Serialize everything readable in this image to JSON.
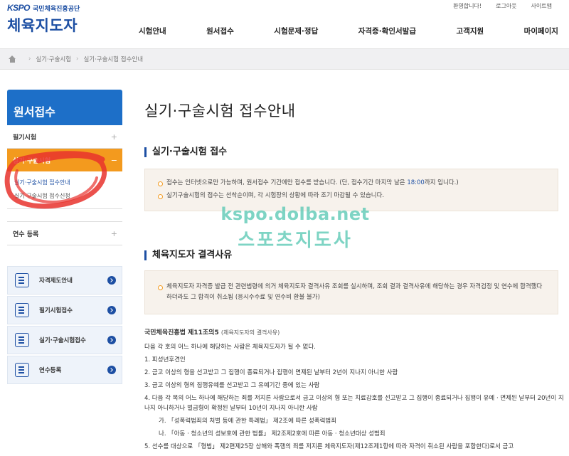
{
  "header": {
    "logo_text": "KSPO",
    "org_name": "국민체육진흥공단",
    "site_title": "체육지도자",
    "util_links": [
      "환영합니다!",
      "로그아웃",
      "사이트맵"
    ],
    "nav": [
      "시험안내",
      "원서접수",
      "시험문제·정답",
      "자격증·확인서발급",
      "고객지원",
      "마이페이지"
    ]
  },
  "breadcrumb": [
    "실기·구술시험",
    "실기·구술시험 접수안내"
  ],
  "sidebar": {
    "title": "원서접수",
    "items": [
      {
        "label": "필기시험",
        "toggle": "+"
      },
      {
        "label": "실기·구술시험",
        "toggle": "−"
      }
    ],
    "sub_items": [
      "실기·구술시험 접수안내",
      "실기·구술시험 접수신청"
    ],
    "enroll": {
      "label": "연수 등록",
      "toggle": "+"
    }
  },
  "quick_menu": [
    {
      "label": "자격제도안내",
      "icon": "qualification-icon"
    },
    {
      "label": "필기시험접수",
      "icon": "document-icon"
    },
    {
      "label": "실기·구술시험접수",
      "icon": "chat-icon"
    },
    {
      "label": "연수등록",
      "icon": "monitor-icon"
    }
  ],
  "main": {
    "page_title": "실기·구술시험 접수안내",
    "section1": {
      "title": "실기·구술시험 접수",
      "line1_a": "접수는 인터넷으로만 가능하며, 원서접수 기간에만 접수를 받습니다. (단, 접수기간 마지막 날은 ",
      "line1_time": "18:00",
      "line1_b": "까지 입니다.)",
      "line2": "실기구술시험의 접수는 선착순이며, 각 시험장의 상황에 따라 조기 마감될 수 있습니다."
    },
    "section2": {
      "title": "체육지도자 결격사유",
      "line": "체육지도자 자격증 발급 전 관련법령에 의거 체육지도자 결격사유 조회를 실시하며, 조회 결과 결격사유에 해당하는 경우 자격검정 및 연수에 합격했다 하더라도 그 합격이 취소됨 (응시수수료 및 연수비 환불 불가)"
    },
    "law": {
      "title": "국민체육진흥법 제11조의5",
      "subtitle": "(체육지도자의 결격사유)",
      "intro": "다음 각 호의 어느 하나에 해당하는 사람은 체육지도자가 될 수 없다.",
      "items": [
        "1. 피성년후견인",
        "2. 금고 이상의 형을 선고받고 그 집행이 종료되거나 집행이 면제된 날부터 2년이 지나지 아니한 사람",
        "3. 금고 이상의 형의 집행유예를 선고받고 그 유예기간 중에 있는 사람",
        "4. 다음 각 목의 어느 하나에 해당하는 죄를 저지른 사람으로서 금고 이상의 형 또는 치료감호를 선고받고 그 집행이 종료되거나 집행이 유예 · 면제된 날부터 20년이 지나지 아니하거나 벌금형이 확정된 날부터 10년이 지나지 아니한 사람"
      ],
      "sub_items": [
        "가. 「성폭력범죄의 처벌 등에 관한 특례법」 제2조에 따른 성폭력범죄",
        "나. 「아동 · 청소년의 성보호에 관한 법률」 제2조제2호에 따른 아동 · 청소년대상 성범죄"
      ],
      "item5": "5. 선수를 대상으로 「형법」 제2편제25장 상해와 폭행의 죄를 저지른 체육지도자(제12조제1항에 따라 자격이 취소된 사람을 포함한다)로서 금고"
    }
  },
  "watermark": {
    "line1": "kspo.dolba.net",
    "line2": "스포츠지도사"
  },
  "colors": {
    "brand_blue": "#1d4fa3",
    "sidebar_blue": "#1d6fc8",
    "accent_orange": "#f39a1e",
    "annotation_red": "#e8322d"
  }
}
